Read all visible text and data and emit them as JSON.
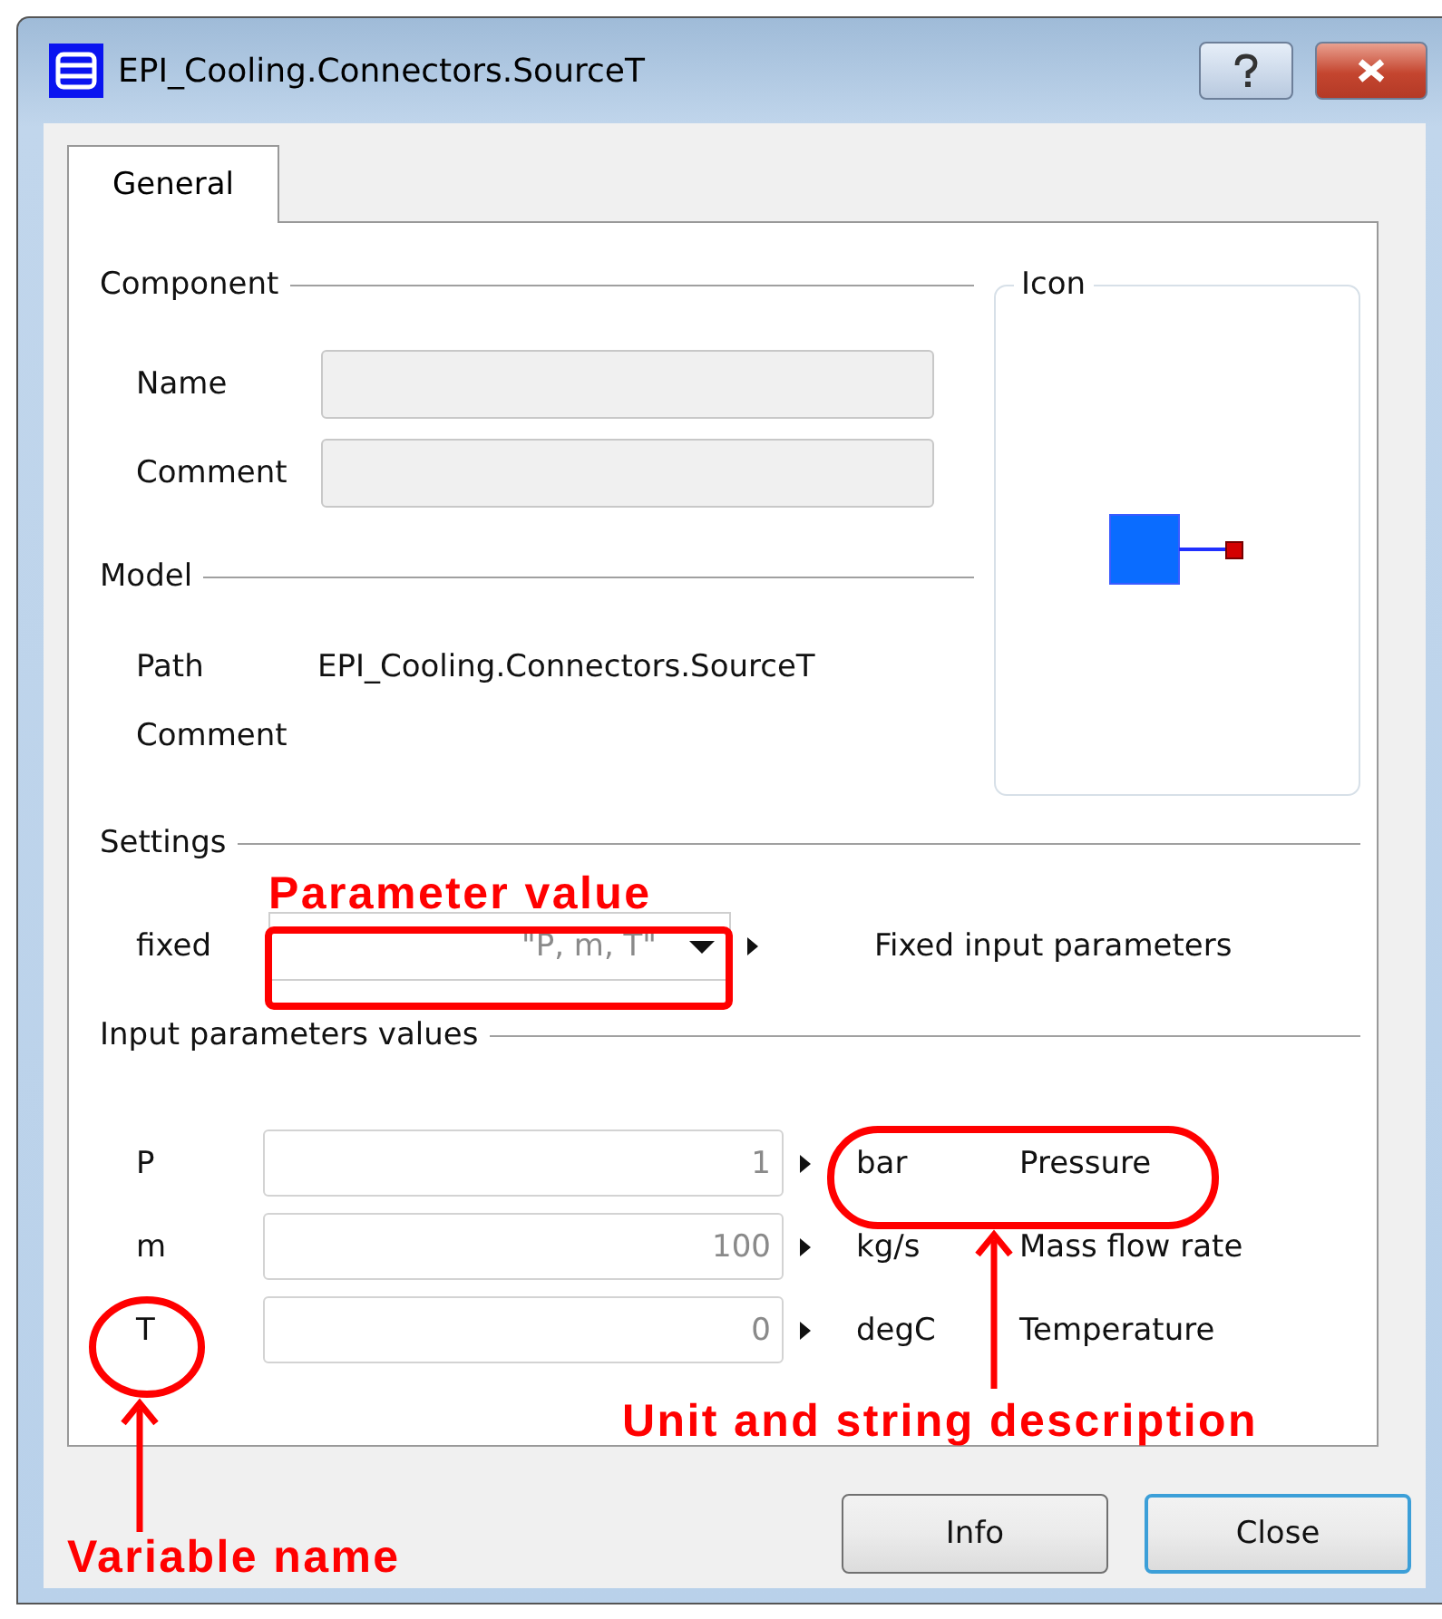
{
  "window": {
    "title": "EPI_Cooling.Connectors.SourceT"
  },
  "tabs": [
    {
      "label": "General",
      "selected": true
    }
  ],
  "component": {
    "heading": "Component",
    "fields": [
      {
        "label": "Name"
      },
      {
        "label": "Comment"
      }
    ]
  },
  "model": {
    "heading": "Model",
    "rows": [
      {
        "label": "Path",
        "value": "EPI_Cooling.Connectors.SourceT"
      },
      {
        "label": "Comment"
      }
    ]
  },
  "icon_group": {
    "heading": "Icon"
  },
  "settings": {
    "heading": "Settings",
    "rows": [
      {
        "label": "fixed",
        "value": "\"P, m, T\"",
        "description": "Fixed input parameters"
      }
    ]
  },
  "inputs": {
    "heading": "Input parameters values",
    "rows": [
      {
        "name": "P",
        "value": "1",
        "unit": "bar",
        "description": "Pressure"
      },
      {
        "name": "m",
        "value": "100",
        "unit": "kg/s",
        "description": "Mass flow rate"
      },
      {
        "name": "T",
        "value": "0",
        "unit": "degC",
        "description": "Temperature"
      }
    ]
  },
  "buttons": [
    {
      "label": "Info",
      "default": false
    },
    {
      "label": "Close",
      "default": true
    }
  ],
  "annotations": [
    {
      "kind": "box",
      "text": "Parameter value"
    },
    {
      "kind": "ellipse",
      "text": "Unit and string description"
    },
    {
      "kind": "circle",
      "text": "Variable name"
    }
  ]
}
